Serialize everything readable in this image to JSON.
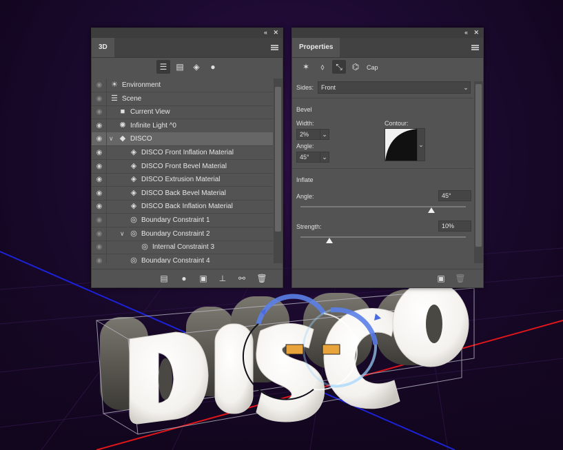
{
  "panel_3d": {
    "title": "3D",
    "filter_icons": [
      "whole-scene-filter-icon",
      "meshes-filter-icon",
      "materials-filter-icon",
      "lights-filter-icon"
    ],
    "rows": [
      {
        "label": "Environment",
        "icon": "☀",
        "indent": 0,
        "chevron": "",
        "eye": "dim"
      },
      {
        "label": "Scene",
        "icon": "☰",
        "indent": 0,
        "chevron": "",
        "eye": "dim"
      },
      {
        "label": "Current View",
        "icon": "■",
        "indent": 1,
        "chevron": "",
        "eye": "dim"
      },
      {
        "label": "Infinite Light ^0",
        "icon": "✺",
        "indent": 1,
        "chevron": "",
        "eye": "on"
      },
      {
        "label": "DISCO",
        "icon": "◆",
        "indent": 1,
        "chevron": "∨",
        "eye": "on",
        "selected": true
      },
      {
        "label": "DISCO Front Inflation Material",
        "icon": "◈",
        "indent": 2,
        "chevron": "",
        "eye": "on"
      },
      {
        "label": "DISCO Front Bevel Material",
        "icon": "◈",
        "indent": 2,
        "chevron": "",
        "eye": "on"
      },
      {
        "label": "DISCO Extrusion Material",
        "icon": "◈",
        "indent": 2,
        "chevron": "",
        "eye": "on"
      },
      {
        "label": "DISCO Back Bevel Material",
        "icon": "◈",
        "indent": 2,
        "chevron": "",
        "eye": "on"
      },
      {
        "label": "DISCO Back Inflation Material",
        "icon": "◈",
        "indent": 2,
        "chevron": "",
        "eye": "on"
      },
      {
        "label": "Boundary Constraint 1",
        "icon": "◎",
        "indent": 2,
        "chevron": "",
        "eye": "dim"
      },
      {
        "label": "Boundary Constraint 2",
        "icon": "◎",
        "indent": 2,
        "chevron": "∨",
        "eye": "dim"
      },
      {
        "label": "Internal Constraint 3",
        "icon": "◎",
        "indent": 3,
        "chevron": "",
        "eye": "dim"
      },
      {
        "label": "Boundary Constraint 4",
        "icon": "◎",
        "indent": 2,
        "chevron": "",
        "eye": "dim"
      }
    ],
    "bottom_icons": [
      "new-mesh-icon",
      "new-light-icon",
      "render-icon",
      "drop-to-plane-icon",
      "split-extrusion-icon",
      "trash-icon"
    ]
  },
  "properties": {
    "title": "Properties",
    "cap_label": "Cap",
    "sides_label": "Sides:",
    "sides_value": "Front",
    "bevel_heading": "Bevel",
    "width_label": "Width:",
    "width_value": "2%",
    "angle_label": "Angle:",
    "angle_value": "45°",
    "contour_label": "Contour:",
    "inflate_heading": "Inflate",
    "inflate_angle_label": "Angle:",
    "inflate_angle_value": "45°",
    "inflate_angle_fraction": 0.79,
    "strength_label": "Strength:",
    "strength_value": "10%",
    "strength_fraction": 0.1
  },
  "scene": {
    "text": "DISCO",
    "x_axis_color": "#e0161b",
    "z_axis_color": "#1b22d8",
    "gizmo_color": "#5b7fe8"
  }
}
